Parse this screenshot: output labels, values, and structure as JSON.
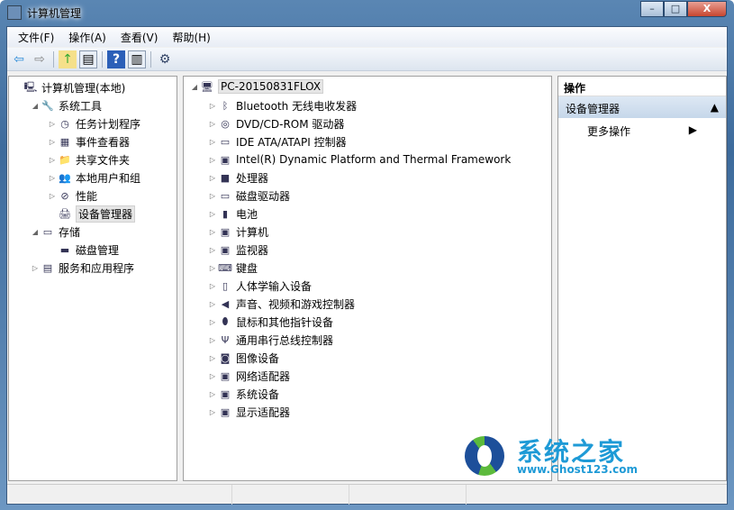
{
  "window": {
    "title": "计算机管理",
    "minimize": "–",
    "maximize": "□",
    "close": "X"
  },
  "menu": [
    "文件(F)",
    "操作(A)",
    "查看(V)",
    "帮助(H)"
  ],
  "toolbar": {
    "back": "⇦",
    "forward": "⇨",
    "up": "↑",
    "show_hide_tree": "▤",
    "help": "?",
    "show_hide_action": "▥",
    "properties": "⚙"
  },
  "left_tree": [
    {
      "label": "计算机管理(本地)",
      "level": 0,
      "arrow": "",
      "icon": "computer-management-icon"
    },
    {
      "label": "系统工具",
      "level": 1,
      "arrow": "◢",
      "icon": "tools-icon"
    },
    {
      "label": "任务计划程序",
      "level": 2,
      "arrow": "▷",
      "icon": "clock-icon"
    },
    {
      "label": "事件查看器",
      "level": 2,
      "arrow": "▷",
      "icon": "event-viewer-icon"
    },
    {
      "label": "共享文件夹",
      "level": 2,
      "arrow": "▷",
      "icon": "shared-folder-icon"
    },
    {
      "label": "本地用户和组",
      "level": 2,
      "arrow": "▷",
      "icon": "users-icon"
    },
    {
      "label": "性能",
      "level": 2,
      "arrow": "▷",
      "icon": "performance-icon"
    },
    {
      "label": "设备管理器",
      "level": 2,
      "arrow": "",
      "icon": "device-manager-icon",
      "selected": true
    },
    {
      "label": "存储",
      "level": 1,
      "arrow": "◢",
      "icon": "storage-icon"
    },
    {
      "label": "磁盘管理",
      "level": 2,
      "arrow": "",
      "icon": "disk-icon"
    },
    {
      "label": "服务和应用程序",
      "level": 1,
      "arrow": "▷",
      "icon": "services-icon"
    }
  ],
  "device_tree": {
    "root": "PC-20150831FLOX",
    "items": [
      {
        "label": "Bluetooth 无线电收发器",
        "icon": "bluetooth-icon"
      },
      {
        "label": "DVD/CD-ROM 驱动器",
        "icon": "dvd-icon"
      },
      {
        "label": "IDE ATA/ATAPI 控制器",
        "icon": "ide-icon"
      },
      {
        "label": "Intel(R) Dynamic Platform and Thermal Framework",
        "icon": "monitor-icon"
      },
      {
        "label": "处理器",
        "icon": "processor-icon"
      },
      {
        "label": "磁盘驱动器",
        "icon": "disk-drive-icon"
      },
      {
        "label": "电池",
        "icon": "battery-icon"
      },
      {
        "label": "计算机",
        "icon": "computer-icon"
      },
      {
        "label": "监视器",
        "icon": "monitor-icon"
      },
      {
        "label": "键盘",
        "icon": "keyboard-icon"
      },
      {
        "label": "人体学输入设备",
        "icon": "hid-icon"
      },
      {
        "label": "声音、视频和游戏控制器",
        "icon": "speaker-icon"
      },
      {
        "label": "鼠标和其他指针设备",
        "icon": "mouse-icon"
      },
      {
        "label": "通用串行总线控制器",
        "icon": "usb-icon"
      },
      {
        "label": "图像设备",
        "icon": "camera-icon"
      },
      {
        "label": "网络适配器",
        "icon": "network-icon"
      },
      {
        "label": "系统设备",
        "icon": "system-device-icon"
      },
      {
        "label": "显示适配器",
        "icon": "display-adapter-icon"
      }
    ]
  },
  "actions": {
    "header": "操作",
    "section": "设备管理器",
    "more": "更多操作"
  },
  "watermark": {
    "name": "系统之家",
    "url": "www.Ghost123.com"
  }
}
